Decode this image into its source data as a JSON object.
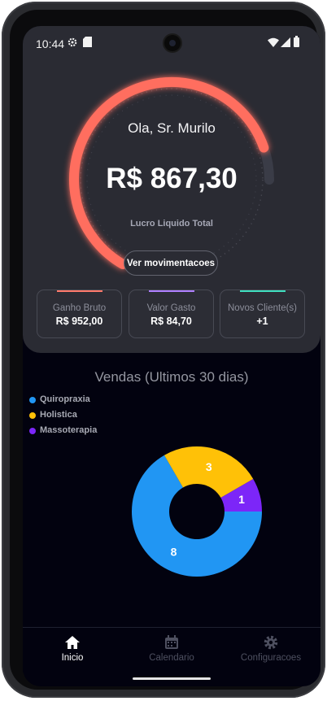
{
  "status_bar": {
    "time": "10:44"
  },
  "header": {
    "greeting": "Ola, Sr. Murilo",
    "amount": "R$ 867,30",
    "amount_label": "Lucro Liquido Total",
    "button_label": "Ver movimentacoes",
    "gauge_fraction": 0.92
  },
  "stats": [
    {
      "label": "Ganho Bruto",
      "value": "R$ 952,00",
      "color": "#ff7a6b"
    },
    {
      "label": "Valor Gasto",
      "value": "R$ 84,70",
      "color": "#b080ff"
    },
    {
      "label": "Novos Cliente(s)",
      "value": "+1",
      "color": "#3fe0c0"
    }
  ],
  "chart_title": "Vendas (Ultimos 30 dias)",
  "colors": {
    "accent": "#ff6e5f",
    "card": "#2a2b33",
    "background": "#02020f"
  },
  "chart_data": {
    "type": "pie",
    "title": "",
    "categories": [
      "Quiropraxia",
      "Holistica",
      "Massoterapia"
    ],
    "values": [
      8,
      3,
      1
    ],
    "colors": [
      "#2196f3",
      "#ffc107",
      "#7c26f8"
    ],
    "legend": "top-left",
    "donut": true
  },
  "nav": [
    {
      "label": "Inicio",
      "icon": "home-icon",
      "active": true
    },
    {
      "label": "Calendario",
      "icon": "calendar-icon",
      "active": false
    },
    {
      "label": "Configuracoes",
      "icon": "gear-icon",
      "active": false
    }
  ]
}
